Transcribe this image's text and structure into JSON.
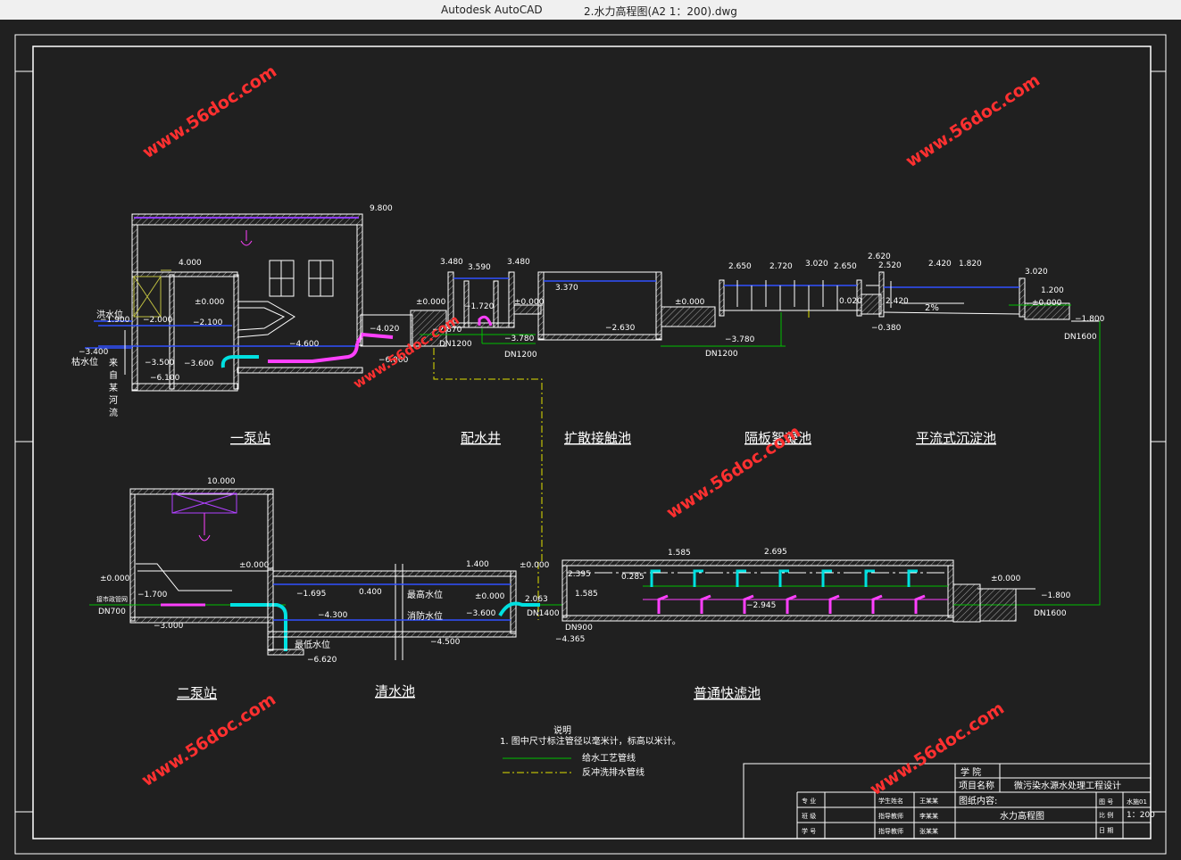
{
  "window": {
    "app": "Autodesk AutoCAD",
    "document": "2.水力高程图(A2 1：200).dwg"
  },
  "watermark": "www.56doc.com",
  "stations": {
    "pump1": "一泵站",
    "well": "配水井",
    "contact": "扩散接触池",
    "flocc": "隔板絮凝池",
    "sedim": "平流式沉淀池",
    "pump2": "二泵站",
    "clearwell": "清水池",
    "filter": "普通快滤池"
  },
  "labels": {
    "flood": "洪水位",
    "dry": "枯水位",
    "river": [
      "来",
      "自",
      "某",
      "河",
      "流"
    ],
    "city_pipe": "接市政管网",
    "max_level": "最高水位",
    "fire_level": "消防水位",
    "min_level": "最低水位",
    "slope": "2%"
  },
  "elevations": {
    "e9800": "9.800",
    "e4000": "4.000",
    "e0000a": "±0.000",
    "e1900": "−1.900",
    "e2000": "−2.000",
    "e2100": "−2.100",
    "e3400": "−3.400",
    "e3500": "−3.500",
    "e3600": "−3.600",
    "e6100": "−6.100",
    "e4600": "−4.600",
    "e4020": "−4.020",
    "e6000": "−6.000",
    "e3480": "3.480",
    "e3590": "3.590",
    "e3480b": "3.480",
    "e0000b": "±0.000",
    "e1720": "−1.720",
    "e0000c": "±0.000",
    "e3780": "−3.780",
    "e2870": "−2.870",
    "e3370": "3.370",
    "e2630": "−2.630",
    "e0000d": "±0.000",
    "e3780b": "−3.780",
    "e2650": "2.650",
    "e2720": "2.720",
    "e3020": "3.020",
    "e2650b": "2.650",
    "e0020": "0.020",
    "e2620": "2.620",
    "e2520": "2.520",
    "e2420": "2.420",
    "e1820": "1.820",
    "e3020b": "3.020",
    "e2420b": "2.420",
    "e0380": "−0.380",
    "e1200": "1.200",
    "e0000e": "±0.000",
    "e1800": "−1.800",
    "e10000": "10.000",
    "e0000f": "±0.000",
    "e0000g": "±0.000",
    "e1700": "−1.700",
    "e3000": "−3.000",
    "e1695": "−1.695",
    "e0400": "0.400",
    "e4300": "−4.300",
    "e6620": "−6.620",
    "e1400": "1.400",
    "e0000h": "±0.000",
    "e3600b": "−3.600",
    "e4500": "−4.500",
    "e0000i": "±0.000",
    "e2063": "2.063",
    "e4365": "−4.365",
    "e1585a": "1.585",
    "e2695": "2.695",
    "e2395": "2.395",
    "e0285": "0.285",
    "e1585b": "1.585",
    "e2945": "−2.945",
    "e0000j": "±0.000",
    "e1800b": "−1.800"
  },
  "pipes": {
    "dn1200a": "DN1200",
    "dn1200b": "DN1200",
    "dn1200c": "DN1200",
    "dn1600a": "DN1600",
    "dn1600b": "DN1600",
    "dn700": "DN700",
    "dn1400": "DN1400",
    "dn900": "DN900"
  },
  "notes": {
    "title": "说明",
    "line1": "1. 图中尺寸标注管径以毫米计，标高以米计。",
    "legend1": "给水工艺管线",
    "legend2": "反冲洗排水管线"
  },
  "titleblock": {
    "school": "学  院",
    "project_label": "项目名称",
    "project": "微污染水源水处理工程设计",
    "content_label": "图纸内容:",
    "content": "水力高程图",
    "no_label": "图  号",
    "no_value": "水施01",
    "scale_label": "比  例",
    "scale_value": "1：200",
    "date_label": "日  期",
    "r1a": "专 业",
    "r2a": "班 级",
    "r3a": "学 号",
    "r1b": "学生姓名",
    "r2b": "指导教师",
    "r3b": "指导教师",
    "r1c": "王某某",
    "r2c": "李某某",
    "r3c": "张某某"
  },
  "colors": {
    "process": "#00c000",
    "backwash": "#e0e000",
    "water": "#3050ff",
    "pipe_magenta": "#ff40ff",
    "pipe_cyan": "#00e0e0",
    "line": "#ffffff"
  }
}
